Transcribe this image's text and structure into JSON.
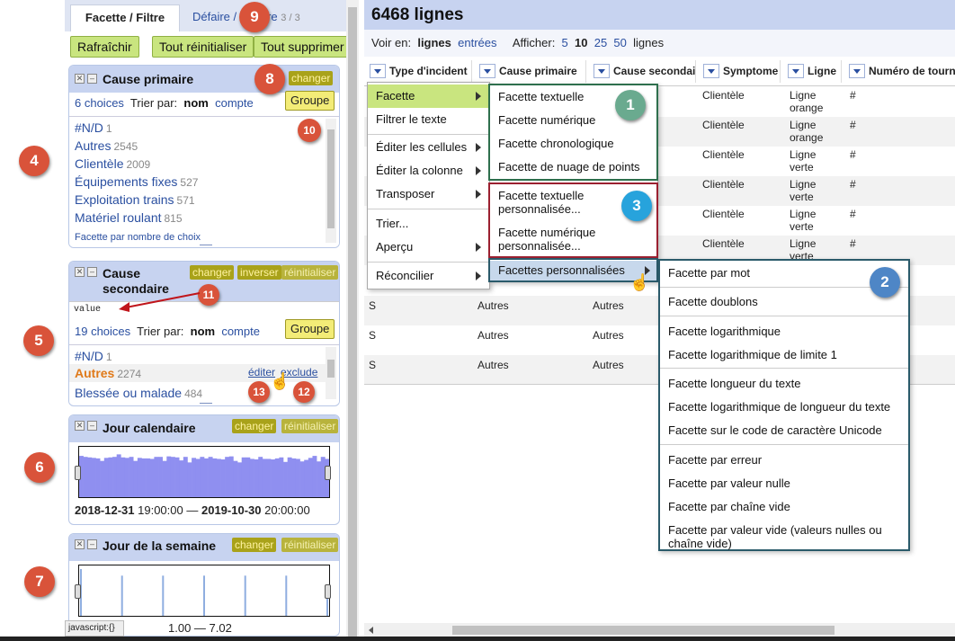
{
  "left_panel": {
    "tabs": {
      "active": "Facette / Filtre",
      "inactive": "Défaire / Refaire",
      "inactive_count": "3 / 3"
    },
    "toolbar": {
      "refresh": "Rafraîchir",
      "reset_all": "Tout réinitialiser",
      "remove_all": "Tout supprimer"
    },
    "facet1": {
      "title": "Cause primaire",
      "change": "changer",
      "choices_count": "6 choices",
      "sort_by": "Trier par:",
      "sort_name": "nom",
      "sort_count": "compte",
      "group": "Groupe",
      "items": [
        {
          "label": "#N/D",
          "count": "1"
        },
        {
          "label": "Autres",
          "count": "2545"
        },
        {
          "label": "Clientèle",
          "count": "2009"
        },
        {
          "label": "Équipements fixes",
          "count": "527"
        },
        {
          "label": "Exploitation trains",
          "count": "571"
        },
        {
          "label": "Matériel roulant",
          "count": "815"
        }
      ],
      "footer_link": "Facette par nombre de choix"
    },
    "facet2": {
      "title": "Cause secondaire",
      "change": "changer",
      "invert": "inverser",
      "reset": "réinitialiser",
      "expression": "value",
      "choices_count": "19 choices",
      "sort_by": "Trier par:",
      "sort_name": "nom",
      "sort_count": "compte",
      "group": "Groupe",
      "items": [
        {
          "label": "#N/D",
          "count": "1"
        },
        {
          "label": "Autres",
          "count": "2274"
        },
        {
          "label": "Blessée ou malade",
          "count": "484"
        }
      ],
      "edit": "éditer",
      "exclude": "exclude"
    },
    "facet3": {
      "title": "Jour calendaire",
      "change": "changer",
      "reset": "réinitialiser",
      "range_start_date": "2018-12-31",
      "range_start_time": "19:00:00",
      "dash": "—",
      "range_end_date": "2019-10-30",
      "range_end_time": "20:00:00"
    },
    "facet4": {
      "title": "Jour de la semaine",
      "change": "changer",
      "reset": "réinitialiser",
      "range": "1.00 — 7.02"
    },
    "status_text": "javascript:{}"
  },
  "main": {
    "row_count": "6468 lignes",
    "view": {
      "voir_en": "Voir en:",
      "lignes": "lignes",
      "entrees": "entrées",
      "afficher": "Afficher:",
      "opts": [
        "5",
        "10",
        "25",
        "50"
      ],
      "suffix": "lignes"
    },
    "columns": [
      "Type d'incident",
      "Cause primaire",
      "Cause secondaire",
      "Symptome",
      "Ligne",
      "Numéro de tournée"
    ],
    "rows": [
      {
        "sym": "Clientèle",
        "ligne1": "Ligne",
        "ligne2": "orange",
        "num": "#"
      },
      {
        "sym": "Clientèle",
        "ligne1": "Ligne",
        "ligne2": "orange",
        "num": "#"
      },
      {
        "sym": "Clientèle",
        "ligne1": "Ligne",
        "ligne2": "verte",
        "num": "#"
      },
      {
        "sym": "Clientèle",
        "ligne1": "Ligne",
        "ligne2": "verte",
        "num": "#"
      },
      {
        "sym": "Clientèle",
        "ligne1": "Ligne",
        "ligne2": "verte",
        "num": "#"
      },
      {
        "sym": "Clientèle",
        "ligne1": "Ligne",
        "ligne2": "verte",
        "num": "#"
      }
    ],
    "lower_rows": [
      {
        "type": "S",
        "c1": "Autres",
        "c2": "Autres"
      },
      {
        "type": "S",
        "c1": "Autres",
        "c2": "Autres"
      },
      {
        "type": "S",
        "c1": "Autres",
        "c2": "Autres"
      }
    ]
  },
  "menu1": [
    "Facette",
    "Filtrer le texte",
    "Éditer les cellules",
    "Éditer la colonne",
    "Transposer",
    "Trier...",
    "Aperçu",
    "Réconcilier"
  ],
  "menu2": [
    "Facette textuelle",
    "Facette numérique",
    "Facette chronologique",
    "Facette de nuage de points",
    "Facette textuelle personnalisée...",
    "Facette numérique personnalisée...",
    "Facettes personnalisées"
  ],
  "menu3": [
    "Facette par mot",
    "Facette doublons",
    "Facette logarithmique",
    "Facette logarithmique de limite 1",
    "Facette longueur du texte",
    "Facette logarithmique de longueur du texte",
    "Facette sur le code de caractère Unicode",
    "Facette par erreur",
    "Facette par valeur nulle",
    "Facette par chaîne vide",
    "Facette par valeur vide (valeurs nulles ou chaîne vide)"
  ],
  "callouts": [
    "1",
    "2",
    "3",
    "4",
    "5",
    "6",
    "7",
    "8",
    "9",
    "10",
    "11",
    "12",
    "13"
  ],
  "charts": {
    "calendar_histogram": [
      0.82,
      0.8,
      0.79,
      0.78,
      0.77,
      0.72,
      0.78,
      0.79,
      0.8,
      0.85,
      0.79,
      0.78,
      0.8,
      0.72,
      0.78,
      0.77,
      0.77,
      0.76,
      0.8,
      0.8,
      0.72,
      0.81,
      0.8,
      0.79,
      0.73,
      0.8,
      0.69,
      0.78,
      0.76,
      0.8,
      0.77,
      0.8,
      0.77,
      0.76,
      0.75,
      0.8,
      0.81,
      0.72,
      0.69,
      0.79,
      0.79,
      0.76,
      0.75,
      0.8,
      0.76,
      0.76,
      0.75,
      0.77,
      0.79,
      0.7,
      0.79,
      0.77,
      0.76,
      0.71,
      0.74,
      0.78,
      0.82,
      0.71,
      0.8,
      0.76
    ],
    "weekday_bars": [
      1,
      0.86,
      0.86,
      0.86,
      0.86,
      0.86,
      0.64
    ]
  },
  "colors": {
    "header_blue": "#c7d3f0",
    "green_button": "#c9e57f",
    "olive_button": "#a9a21a",
    "callout_red": "#d9533a"
  }
}
